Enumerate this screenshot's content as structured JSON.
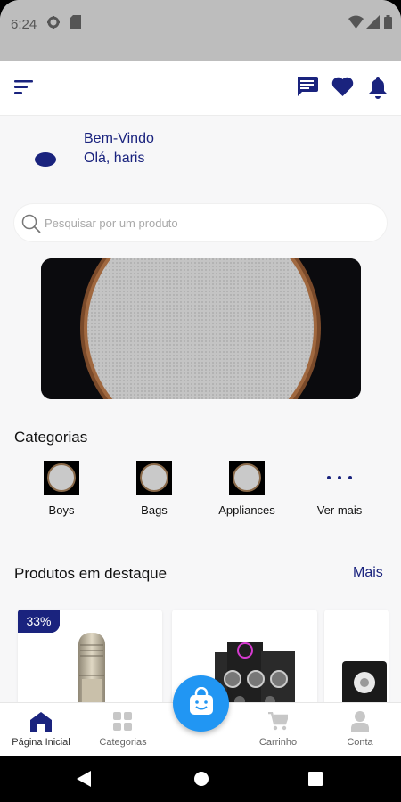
{
  "status_bar": {
    "time": "6:24"
  },
  "greeting": {
    "title": "Bem-Vindo",
    "subtitle": "Olá, haris"
  },
  "search": {
    "placeholder": "Pesquisar por um produto"
  },
  "categories": {
    "title": "Categorias",
    "items": [
      {
        "label": "Boys"
      },
      {
        "label": "Bags"
      },
      {
        "label": "Appliances"
      },
      {
        "label": "Ver mais"
      }
    ]
  },
  "featured": {
    "title": "Produtos em destaque",
    "more_label": "Mais",
    "products": [
      {
        "discount": "33%"
      }
    ]
  },
  "bottom_nav": {
    "items": [
      {
        "label": "Página Inicial",
        "icon": "home-icon",
        "active": true
      },
      {
        "label": "Categorias",
        "icon": "grid-icon",
        "active": false
      },
      {
        "label": "Carrinho",
        "icon": "cart-icon",
        "active": false
      },
      {
        "label": "Conta",
        "icon": "person-icon",
        "active": false
      }
    ],
    "fab_icon": "shopping-bag-icon"
  },
  "colors": {
    "primary": "#1a237e",
    "fab": "#2196f3",
    "background": "#f7f7f8",
    "status_bar": "#bdbdbd"
  }
}
